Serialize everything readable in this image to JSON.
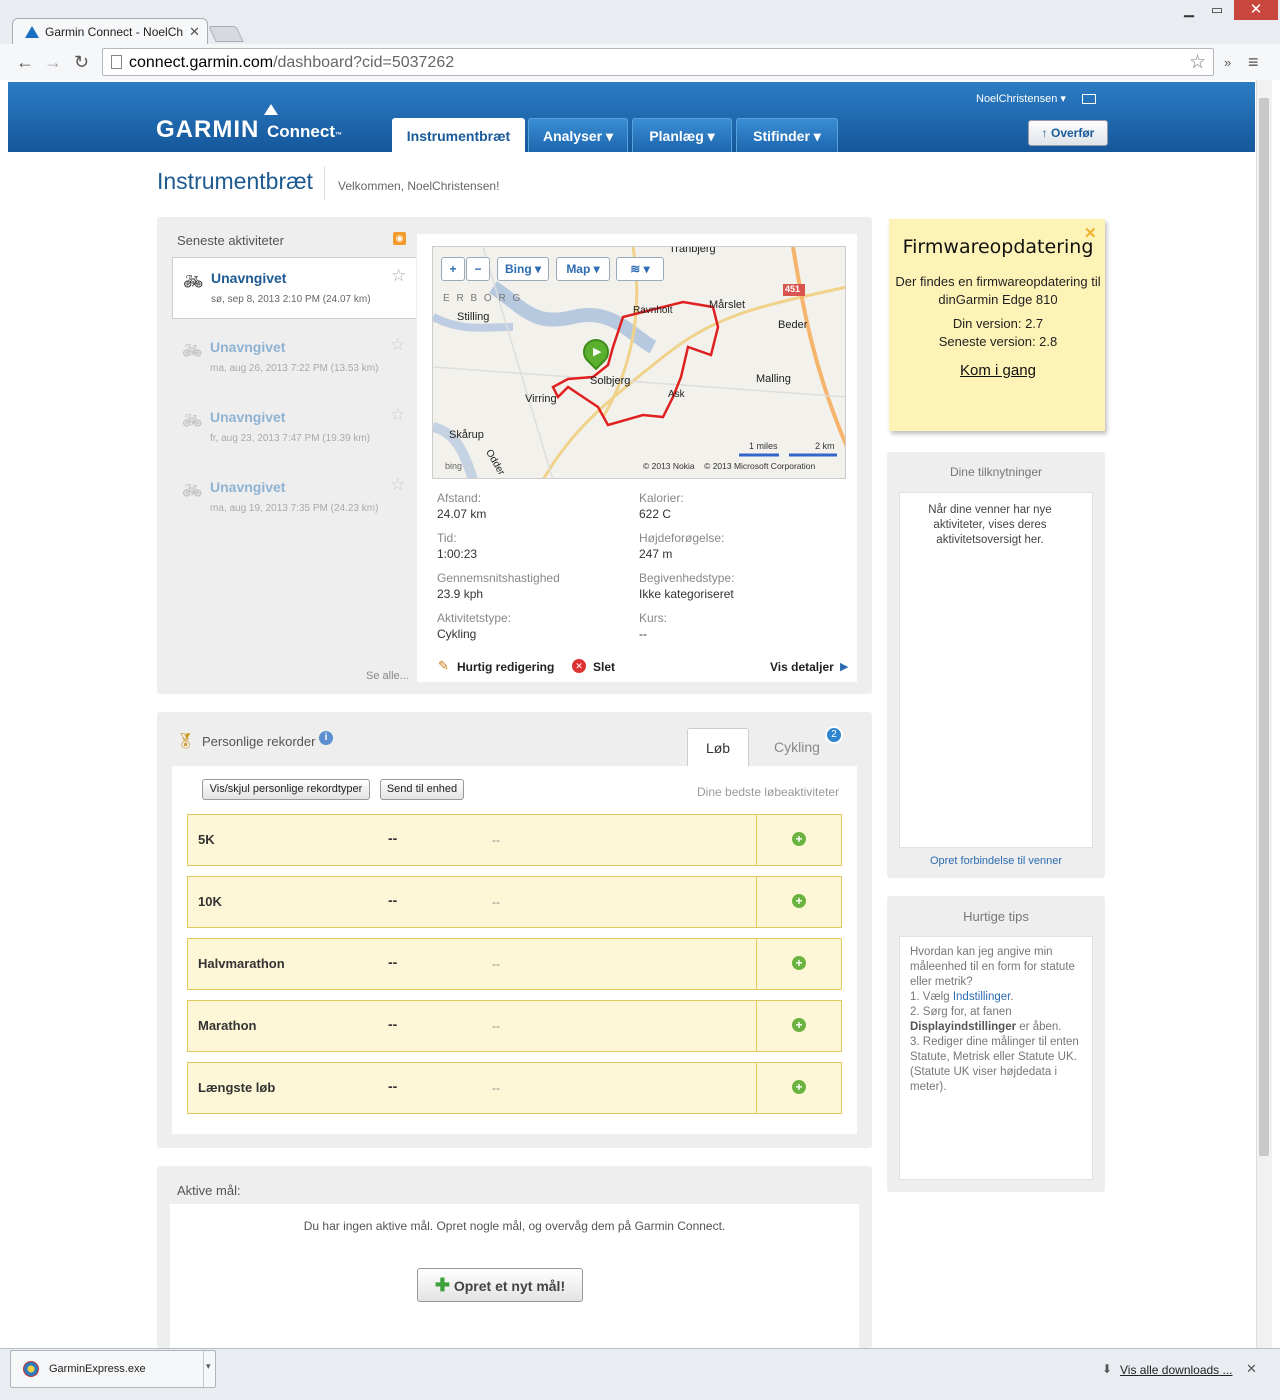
{
  "browser": {
    "tab_title": "Garmin Connect - NoelCh",
    "url_host": "connect.garmin.com",
    "url_path": "/dashboard?cid=5037262"
  },
  "header": {
    "logo_main": "GARMIN",
    "logo_sub": "Connect",
    "logo_tm": "™",
    "username": "NoelChristensen ▾",
    "nav": [
      "Instrumentbræt",
      "Analyser ▾",
      "Planlæg ▾",
      "Stifinder ▾"
    ],
    "upload": "Overfør"
  },
  "page": {
    "title": "Instrumentbræt",
    "welcome": "Velkommen, NoelChristensen!"
  },
  "recent": {
    "heading": "Seneste aktiviteter",
    "see_all": "Se alle...",
    "items": [
      {
        "name": "Unavngivet",
        "meta": "sø, sep 8, 2013 2:10 PM (24.07 km)"
      },
      {
        "name": "Unavngivet",
        "meta": "ma, aug 26, 2013 7:22 PM (13.53 km)"
      },
      {
        "name": "Unavngivet",
        "meta": "fr, aug 23, 2013 7:47 PM (19.39 km)"
      },
      {
        "name": "Unavngivet",
        "meta": "ma, aug 19, 2013 7:35 PM (24.23 km)"
      }
    ]
  },
  "map": {
    "buttons": [
      "+",
      "−",
      "Bing ▾",
      "Map ▾",
      "≋ ▾"
    ],
    "towns": [
      "Tranbjerg",
      "Stilling",
      "Ravnholt",
      "Mårslet",
      "Beder",
      "Solbjerg",
      "Virring",
      "Malling",
      "Ask",
      "Skårup",
      "Odder"
    ],
    "erborg": "E R B O R G",
    "road": "451",
    "scale_miles": "1 miles",
    "scale_km": "2 km",
    "copyright": "© 2013 Nokia    © 2013 Microsoft Corporation",
    "bing": "bing"
  },
  "activity": {
    "stats": [
      {
        "label": "Afstand:",
        "value": "24.07 km"
      },
      {
        "label": "Kalorier:",
        "value": "622 C"
      },
      {
        "label": "Tid:",
        "value": "1:00:23"
      },
      {
        "label": "Højdeforøgelse:",
        "value": "247 m"
      },
      {
        "label": "Gennemsnitshastighed",
        "value": "23.9 kph"
      },
      {
        "label": "Begivenhedstype:",
        "value": "Ikke kategoriseret"
      },
      {
        "label": "Aktivitetstype:",
        "value": "Cykling"
      },
      {
        "label": "Kurs:",
        "value": "--"
      }
    ],
    "quick_edit": "Hurtig redigering",
    "delete": "Slet",
    "details": "Vis detaljer"
  },
  "records": {
    "heading": "Personlige rekorder",
    "tabs": [
      "Løb",
      "Cykling"
    ],
    "badge": "2",
    "btn_toggle": "Vis/skjul personlige rekordtyper",
    "btn_send": "Send til enhed",
    "best_label": "Dine bedste løbeaktiviteter",
    "rows": [
      {
        "name": "5K",
        "v1": "--",
        "v2": "--"
      },
      {
        "name": "10K",
        "v1": "--",
        "v2": "--"
      },
      {
        "name": "Halvmarathon",
        "v1": "--",
        "v2": "--"
      },
      {
        "name": "Marathon",
        "v1": "--",
        "v2": "--"
      },
      {
        "name": "Længste løb",
        "v1": "--",
        "v2": "--"
      }
    ]
  },
  "goals": {
    "heading": "Aktive mål:",
    "empty": "Du har ingen aktive mål. Opret nogle mål, og overvåg dem på Garmin Connect.",
    "create": "Opret et nyt mål!"
  },
  "firmware": {
    "title": "Firmwareopdatering",
    "text": "Der findes en firmwareopdatering til dinGarmin Edge 810",
    "your_version": "Din version: 2.7",
    "latest_version": "Seneste version: 2.8",
    "cta": "Kom i gang"
  },
  "connections": {
    "heading": "Dine tilknytninger",
    "text": "Når dine venner har nye aktiviteter, vises deres aktivitetsoversigt her.",
    "link": "Opret forbindelse til venner"
  },
  "tips": {
    "heading": "Hurtige tips",
    "intro": "Hvordan kan jeg angive min måleenhed til en form for statute eller metrik?",
    "s1a": "1. Vælg ",
    "s1link": "Indstillinger",
    "s1b": ".",
    "s2a": "2. Sørg for, at fanen ",
    "s2bold": "Displayindstillinger",
    "s2b": " er åben.",
    "s3": "3. Rediger dine målinger til enten Statute, Metrisk eller Statute UK. (Statute UK viser højdedata i meter)."
  },
  "downloads": {
    "file": "GarminExpress.exe",
    "show_all": "Vis alle downloads ..."
  },
  "colors": {
    "brand_blue": "#1d66ae",
    "link": "#1d5a91",
    "record_bg": "#fdf7d7",
    "route": "#e02020"
  }
}
